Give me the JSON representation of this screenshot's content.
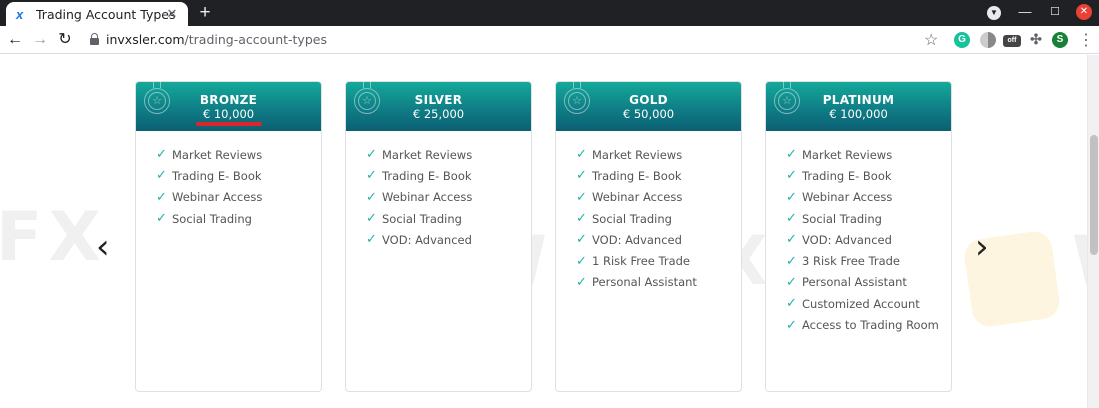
{
  "browser": {
    "tab_title": "Trading Account Types",
    "tab_close": "✕",
    "new_tab": "+",
    "url_host": "invxsler.com",
    "url_path": "/trading-account-types",
    "avatar_letter": "S",
    "ext_off_label": "off"
  },
  "page": {
    "watermark_text": "WikiFX",
    "watermark_partial_left": "FX",
    "prev_arrow": "‹",
    "next_arrow": "›",
    "accent_color": "#1bb5a7",
    "header_gradient": [
      "#14a99a",
      "#0b5f72"
    ],
    "highlight_color": "#e0242b"
  },
  "plans": [
    {
      "name": "BRONZE",
      "price": "€ 10,000",
      "features": [
        "Market Reviews",
        "Trading E- Book",
        "Webinar Access",
        "Social Trading"
      ]
    },
    {
      "name": "SILVER",
      "price": "€ 25,000",
      "features": [
        "Market Reviews",
        "Trading E- Book",
        "Webinar Access",
        "Social Trading",
        "VOD: Advanced"
      ]
    },
    {
      "name": "GOLD",
      "price": "€ 50,000",
      "features": [
        "Market Reviews",
        "Trading E- Book",
        "Webinar Access",
        "Social Trading",
        "VOD: Advanced",
        "1 Risk Free Trade",
        "Personal Assistant"
      ]
    },
    {
      "name": "PLATINUM",
      "price": "€ 100,000",
      "features": [
        "Market Reviews",
        "Trading E- Book",
        "Webinar Access",
        "Social Trading",
        "VOD: Advanced",
        "3 Risk Free Trade",
        "Personal Assistant",
        "Customized Account",
        "Access to Trading Room"
      ]
    }
  ]
}
